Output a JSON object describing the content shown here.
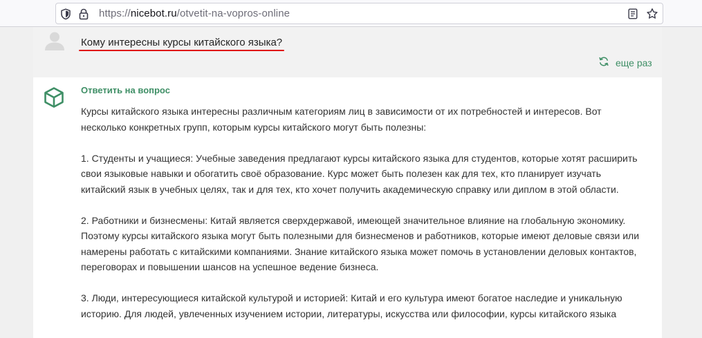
{
  "browser": {
    "url_protocol": "https://",
    "url_host": "nicebot.ru",
    "url_path": "/otvetit-na-vopros-online"
  },
  "question": {
    "text": "Кому интересны курсы китайского языка?",
    "underline_color": "#e01010"
  },
  "again_button": {
    "label": "еще раз",
    "icon": "refresh-icon"
  },
  "answer": {
    "heading": "Ответить на вопрос",
    "icon": "cube-icon",
    "accent_color": "#3f8f66",
    "paragraphs": [
      "Курсы китайского языка интересны различным категориям лиц в зависимости от их потребностей и интересов. Вот несколько конкретных групп, которым курсы китайского могут быть полезны:",
      "1. Студенты и учащиеся: Учебные заведения предлагают курсы китайского языка для студентов, которые хотят расширить свои языковые навыки и обогатить своё образование. Курс может быть полезен как для тех, кто планирует изучать китайский язык в учебных целях, так и для тех, кто хочет получить академическую справку или диплом в этой области.",
      "2. Работники и бизнесмены: Китай является сверхдержавой, имеющей значительное влияние на глобальную экономику. Поэтому курсы китайского языка могут быть полезными для бизнесменов и работников, которые имеют деловые связи или намерены работать с китайскими компаниями. Знание китайского языка может помочь в установлении деловых контактов, переговорах и повышении шансов на успешное ведение бизнеса.",
      "3. Люди, интересующиеся китайской культурой и историей: Китай и его культура имеют богатое наследие и уникальную историю. Для людей, увлеченных изучением истории, литературы, искусства или философии, курсы китайского языка"
    ]
  }
}
